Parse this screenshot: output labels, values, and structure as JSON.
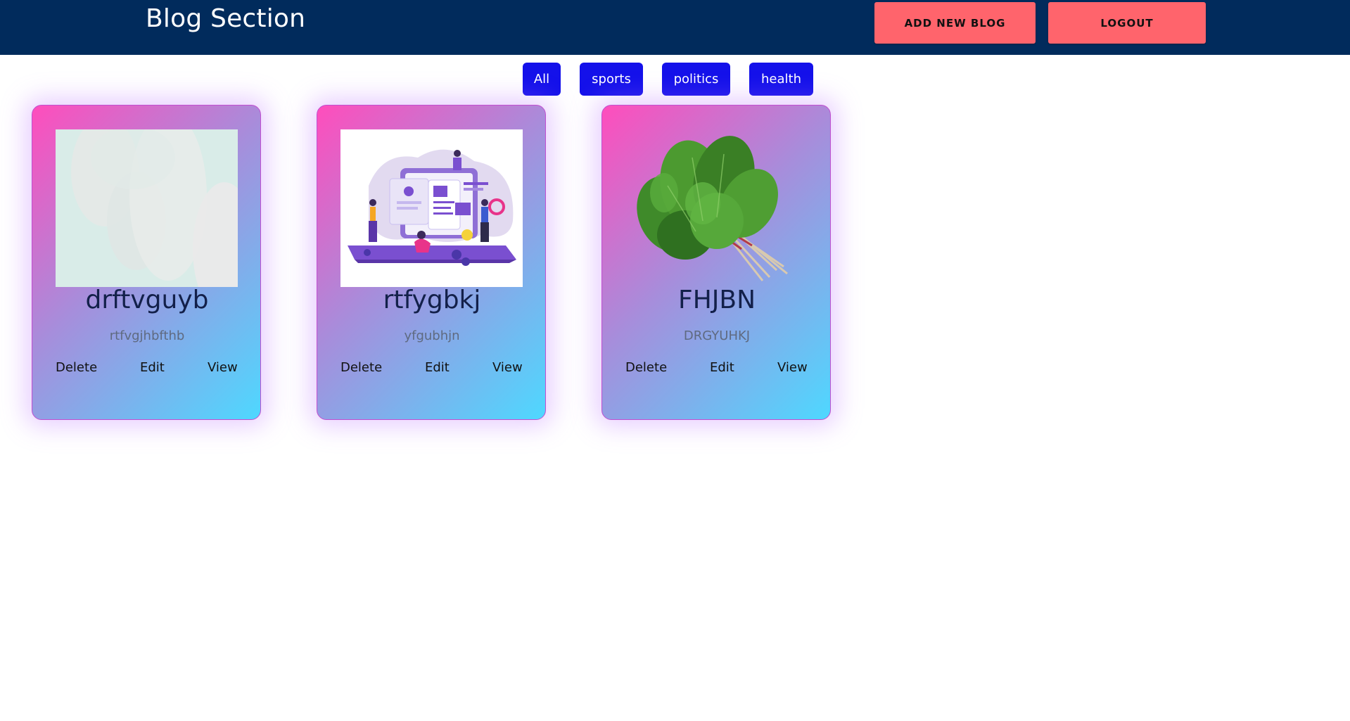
{
  "header": {
    "title": "Blog Section",
    "add_new_blog_label": "ADD NEW BLOG",
    "logout_label": "LOGOUT"
  },
  "filters": [
    {
      "label": "All"
    },
    {
      "label": "sports"
    },
    {
      "label": "politics"
    },
    {
      "label": "health"
    }
  ],
  "blogs": [
    {
      "title": "drftvguyb",
      "subtitle": "rtfvgjhbfthb",
      "image": "abstract-pale-image",
      "actions": {
        "delete": "Delete",
        "edit": "Edit",
        "view": "View"
      }
    },
    {
      "title": "rtfygbkj",
      "subtitle": "yfgubhjn",
      "image": "dashboard-illustration-image",
      "actions": {
        "delete": "Delete",
        "edit": "Edit",
        "view": "View"
      }
    },
    {
      "title": "FHJBN",
      "subtitle": "DRGYUHKJ",
      "image": "spinach-image",
      "actions": {
        "delete": "Delete",
        "edit": "Edit",
        "view": "View"
      }
    }
  ],
  "colors": {
    "navbar": "#012b5c",
    "nav_button": "#ff646c",
    "filter_button": "#1411ea",
    "card_gradient_start": "#ff4dbc",
    "card_gradient_end": "#4ed8ff"
  }
}
